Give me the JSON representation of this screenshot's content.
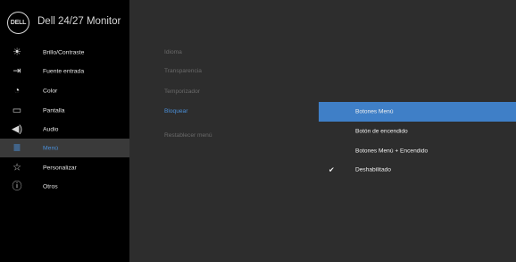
{
  "app": {
    "logo_text": "DELL",
    "title": "Dell 24/27 Monitor"
  },
  "sidebar": {
    "items": [
      {
        "label": "Brillo/Contraste",
        "icon": "brightness-icon",
        "glyph": "☀"
      },
      {
        "label": "Fuente entrada",
        "icon": "input-source-icon",
        "glyph": "⇥"
      },
      {
        "label": "Color",
        "icon": "color-palette-icon",
        "glyph": "◔"
      },
      {
        "label": "Pantalla",
        "icon": "display-icon",
        "glyph": "▭"
      },
      {
        "label": "Audio",
        "icon": "speaker-icon",
        "glyph": "◀)"
      },
      {
        "label": "Menú",
        "icon": "menu-icon",
        "glyph": "≣"
      },
      {
        "label": "Personalizar",
        "icon": "star-icon",
        "glyph": "☆"
      },
      {
        "label": "Otros",
        "icon": "info-icon",
        "glyph": "ⓘ"
      }
    ]
  },
  "submenu": {
    "items": [
      {
        "label": "Idioma"
      },
      {
        "label": "Transparencia"
      },
      {
        "label": "Temporizador"
      },
      {
        "label": "Bloquear"
      },
      {
        "label": "Restablecer menú"
      }
    ]
  },
  "options": {
    "items": [
      {
        "label": "Botones Menú"
      },
      {
        "label": "Botón de encendido"
      },
      {
        "label": "Botones Menú + Encendido"
      },
      {
        "label": "Deshabilitado",
        "check": "✔"
      }
    ]
  },
  "colors": {
    "accent": "#4a8fd8",
    "selection": "#3f7fc7",
    "sidebar": "#000000",
    "panel": "#2d2d2d"
  }
}
